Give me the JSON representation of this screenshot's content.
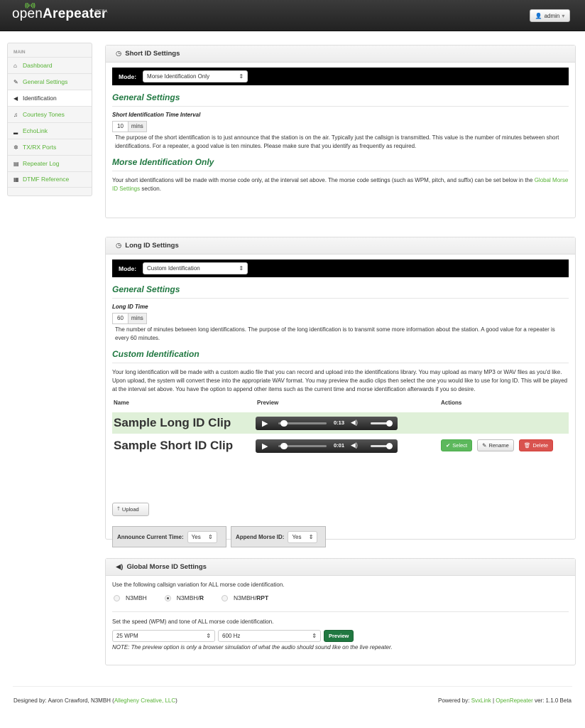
{
  "app": {
    "logo_open": "open",
    "logo_repeater": "Arepeater",
    "beta": "BETA",
    "user": "admin"
  },
  "sidebar": {
    "header": "MAIN",
    "items": [
      {
        "label": "Dashboard",
        "icon": "home-icon",
        "glyph": "⌂"
      },
      {
        "label": "General Settings",
        "icon": "wrench-icon",
        "glyph": "✎"
      },
      {
        "label": "Identification",
        "icon": "bullhorn-icon",
        "glyph": "◀"
      },
      {
        "label": "Courtesy Tones",
        "icon": "music-icon",
        "glyph": "♫"
      },
      {
        "label": "EchoLink",
        "icon": "signal-icon",
        "glyph": "▂"
      },
      {
        "label": "TX/RX Ports",
        "icon": "cog-icon",
        "glyph": "✲"
      },
      {
        "label": "Repeater Log",
        "icon": "list-icon",
        "glyph": "▤"
      },
      {
        "label": "DTMF Reference",
        "icon": "keypad-icon",
        "glyph": "▦"
      }
    ]
  },
  "short_id": {
    "title": "Short ID Settings",
    "mode_label": "Mode:",
    "mode_value": "Morse Identification Only",
    "general_title": "General Settings",
    "interval_label": "Short Identification Time Interval",
    "interval_value": "10",
    "interval_unit": "mins",
    "interval_help": "The purpose of the short identification is to just announce that the station is on the air. Typically just the callsign is transmitted. This value is the number of minutes between short identifications. For a repeater, a good value is ten minutes. Please make sure that you identify as frequently as required.",
    "morse_title": "Morse Identification Only",
    "morse_text": "Your short identifications will be made with morse code only, at the interval set above. The morse code settings (such as WPM, pitch, and suffix) can be set below in the",
    "morse_link": "Global Morse ID Settings",
    "morse_text_end": "section."
  },
  "long_id": {
    "title": "Long ID Settings",
    "mode_label": "Mode:",
    "mode_value": "Custom Identification",
    "general_title": "General Settings",
    "time_label": "Long ID Time",
    "time_value": "60",
    "time_unit": "mins",
    "time_help": "The number of minutes between long identifications. The purpose of the long identification is to transmit some more information about the station. A good value for a repeater is every 60 minutes.",
    "custom_title": "Custom Identification",
    "custom_text": "Your long identification will be made with a custom audio file that you can record and upload into the identifications library. You may upload as many MP3 or WAV files as you'd like. Upon upload, the system will convert these into the appropriate WAV format. You may preview the audio clips then select the one you would like to use for long ID. This will be played at the interval set above. You have the option to append other items such as the current time and morse identification afterwards if you so desire.",
    "col_name": "Name",
    "col_preview": "Preview",
    "col_actions": "Actions",
    "clips": [
      {
        "name": "Sample Long ID Clip",
        "time": "0:13"
      },
      {
        "name": "Sample Short ID Clip",
        "time": "0:01"
      }
    ],
    "select_label": "Select",
    "rename_label": "Rename",
    "delete_label": "Delete",
    "upload_label": "Upload",
    "announce_label": "Announce Current Time:",
    "announce_value": "Yes",
    "append_label": "Append Morse ID:",
    "append_value": "Yes"
  },
  "morse": {
    "title": "Global Morse ID Settings",
    "callsign_text": "Use the following callsign variation for ALL morse code identification.",
    "opt1": "N3MBH",
    "opt2_base": "N3MBH/",
    "opt2_bold": "R",
    "opt3_base": "N3MBH/",
    "opt3_bold": "RPT",
    "speed_text": "Set the speed (WPM) and tone of ALL morse code identification.",
    "wpm": "25 WPM",
    "tone": "600 Hz",
    "preview_label": "Preview",
    "note": "NOTE: The preview option is only a browser simulation of what the audio should sound like on the live repeater."
  },
  "footer": {
    "designed": "Designed by: Aaron Crawford, N3MBH (",
    "designed_link": "Allegheny Creative, LLC",
    "designed_end": ")",
    "powered": "Powered by:",
    "svx": "SvxLink",
    "sep": "|",
    "or": "OpenRepeater",
    "version": "ver: 1.1.0 Beta"
  }
}
